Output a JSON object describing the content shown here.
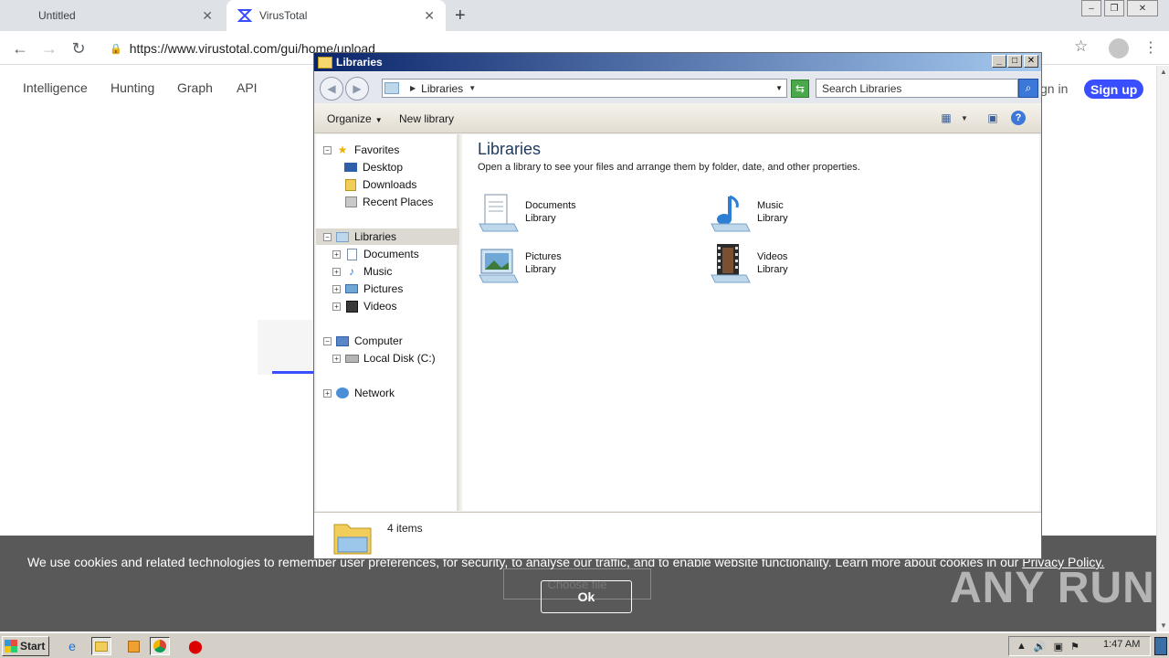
{
  "browser": {
    "tabs": [
      {
        "title": "Untitled",
        "active": false
      },
      {
        "title": "VirusTotal",
        "active": true
      }
    ],
    "new_tab": "+",
    "url": "https://www.virustotal.com/gui/home/upload",
    "tab_close": "✕"
  },
  "vt": {
    "nav": [
      "Intelligence",
      "Hunting",
      "Graph",
      "API"
    ],
    "sign_in": "gn in",
    "sign_up": "Sign up",
    "choose_files": "Choose file",
    "cookie_text": "We use cookies and related technologies to remember user preferences, for security, to analyse our traffic, and to enable website functionality. Learn more about cookies in our",
    "cookie_link": "Privacy Policy.",
    "ok": "Ok",
    "watermark": "ANY RUN"
  },
  "explorer": {
    "title": "Libraries",
    "path": "Libraries",
    "search_placeholder": "Search Libraries",
    "organize": "Organize",
    "new_library": "New library",
    "nav": {
      "favorites": "Favorites",
      "desktop": "Desktop",
      "downloads": "Downloads",
      "recent": "Recent Places",
      "libraries": "Libraries",
      "documents": "Documents",
      "music": "Music",
      "pictures": "Pictures",
      "videos": "Videos",
      "computer": "Computer",
      "local_disk": "Local Disk (C:)",
      "network": "Network"
    },
    "heading": "Libraries",
    "subheading": "Open a library to see your files and arrange them by folder, date, and other properties.",
    "libraries": [
      {
        "name": "Documents",
        "type": "Library"
      },
      {
        "name": "Music",
        "type": "Library"
      },
      {
        "name": "Pictures",
        "type": "Library"
      },
      {
        "name": "Videos",
        "type": "Library"
      }
    ],
    "status": "4 items"
  },
  "taskbar": {
    "start": "Start",
    "clock": "1:47 AM"
  },
  "colors": {
    "vt_accent": "#394eff",
    "title_gradient_start": "#0a246a",
    "taskbar": "#d4d0c8"
  }
}
